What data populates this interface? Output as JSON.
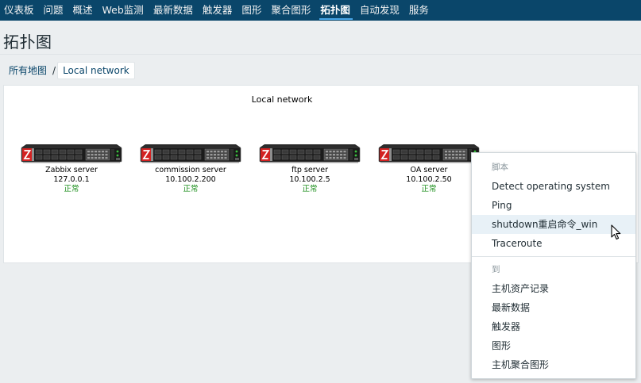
{
  "nav": {
    "items": [
      {
        "label": "仪表板"
      },
      {
        "label": "问题"
      },
      {
        "label": "概述"
      },
      {
        "label": "Web监测"
      },
      {
        "label": "最新数据"
      },
      {
        "label": "触发器"
      },
      {
        "label": "图形"
      },
      {
        "label": "聚合图形"
      },
      {
        "label": "拓扑图",
        "active": true
      },
      {
        "label": "自动发现"
      },
      {
        "label": "服务"
      }
    ]
  },
  "page": {
    "title": "拓扑图"
  },
  "breadcrumb": {
    "all_maps": "所有地图",
    "separator": "/",
    "current": "Local network"
  },
  "map": {
    "title": "Local network",
    "hosts": [
      {
        "name": "Zabbix server",
        "ip": "127.0.0.1",
        "status": "正常",
        "icon": "rack-server-icon"
      },
      {
        "name": "commission server",
        "ip": "10.100.2.200",
        "status": "正常",
        "icon": "rack-server-icon"
      },
      {
        "name": "ftp server",
        "ip": "10.100.2.5",
        "status": "正常",
        "icon": "rack-server-icon"
      },
      {
        "name": "OA server",
        "ip": "10.100.2.50",
        "status": "正常",
        "icon": "rack-server-icon"
      }
    ]
  },
  "context_menu": {
    "scripts_header": "脚本",
    "scripts": [
      "Detect operating system",
      "Ping",
      "shutdown重启命令_win",
      "Traceroute"
    ],
    "goto_header": "到",
    "goto": [
      "主机资产记录",
      "最新数据",
      "触发器",
      "图形",
      "主机聚合图形"
    ]
  },
  "colors": {
    "nav_bg": "#0a466a",
    "status_ok": "#1b8e1b",
    "link": "#0a466a",
    "hover_bg": "#e8f1f7"
  }
}
